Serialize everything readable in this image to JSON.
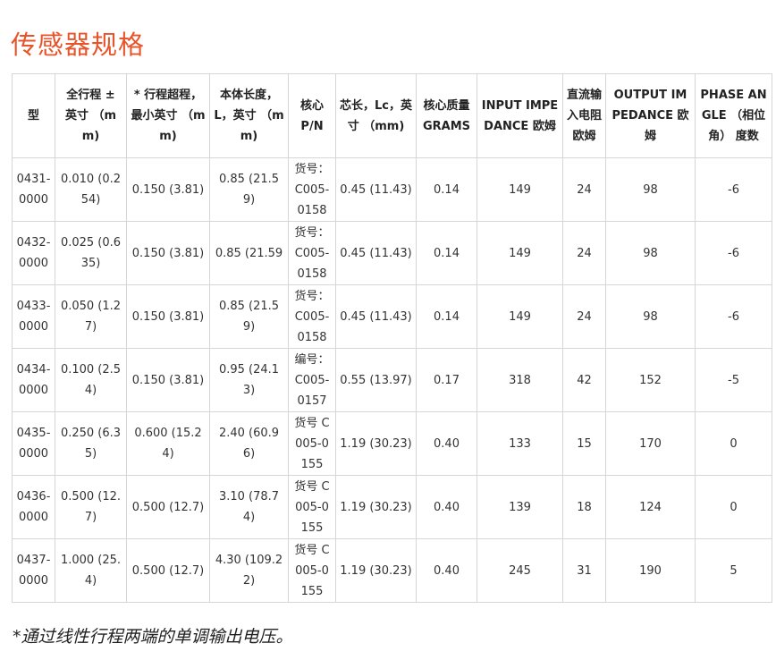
{
  "accent_color": "#e8542a",
  "page_title": "传感器规格",
  "table": {
    "headers": [
      "型",
      "全行程 ± 英寸 （mm)",
      "* 行程超程，最小英寸 （mm)",
      "本体长度，L，英寸 （mm)",
      "核心 P/N",
      "芯长，Lc，英寸 （mm)",
      "核心质量 GRAMS",
      "INPUT IMPEDANCE 欧姆",
      "直流输入电阻欧姆",
      "OUTPUT IMPEDANCE 欧姆",
      "PHASE ANGLE （相位角） 度数"
    ],
    "rows": [
      {
        "model": "0431-0000",
        "stroke": "0.010 (0.254)",
        "overtravel": "0.150 (3.81)",
        "body_length": "0.85 (21.59)",
        "core_pn": "货号：C005-0158",
        "core_length": "0.45 (11.43)",
        "core_mass": "0.14",
        "input_impedance": "149",
        "dc_resistance": "24",
        "output_impedance": "98",
        "phase_angle": "-6"
      },
      {
        "model": "0432-0000",
        "stroke": "0.025 (0.635)",
        "overtravel": "0.150 (3.81)",
        "body_length": "0.85 (21.59",
        "core_pn": "货号：C005-0158",
        "core_length": "0.45 (11.43)",
        "core_mass": "0.14",
        "input_impedance": "149",
        "dc_resistance": "24",
        "output_impedance": "98",
        "phase_angle": "-6"
      },
      {
        "model": "0433-0000",
        "stroke": "0.050 (1.27)",
        "overtravel": "0.150 (3.81)",
        "body_length": "0.85 (21.59)",
        "core_pn": "货号：C005-0158",
        "core_length": "0.45 (11.43)",
        "core_mass": "0.14",
        "input_impedance": "149",
        "dc_resistance": "24",
        "output_impedance": "98",
        "phase_angle": "-6"
      },
      {
        "model": "0434-0000",
        "stroke": "0.100 (2.54)",
        "overtravel": "0.150 (3.81)",
        "body_length": "0.95 (24.13)",
        "core_pn": "编号：C005-0157",
        "core_length": "0.55 (13.97)",
        "core_mass": "0.17",
        "input_impedance": "318",
        "dc_resistance": "42",
        "output_impedance": "152",
        "phase_angle": "-5"
      },
      {
        "model": "0435-0000",
        "stroke": "0.250 (6.35)",
        "overtravel": "0.600 (15.24)",
        "body_length": "2.40 (60.96)",
        "core_pn": "货号 C005-0155",
        "core_length": "1.19 (30.23)",
        "core_mass": "0.40",
        "input_impedance": "133",
        "dc_resistance": "15",
        "output_impedance": "170",
        "phase_angle": "0"
      },
      {
        "model": "0436-0000",
        "stroke": "0.500 (12.7)",
        "overtravel": "0.500 (12.7)",
        "body_length": "3.10 (78.74)",
        "core_pn": "货号 C005-0155",
        "core_length": "1.19 (30.23)",
        "core_mass": "0.40",
        "input_impedance": "139",
        "dc_resistance": "18",
        "output_impedance": "124",
        "phase_angle": "0"
      },
      {
        "model": "0437-0000",
        "stroke": "1.000 (25.4)",
        "overtravel": "0.500 (12.7)",
        "body_length": "4.30 (109.22)",
        "core_pn": "货号 C005-0155",
        "core_length": "1.19 (30.23)",
        "core_mass": "0.40",
        "input_impedance": "245",
        "dc_resistance": "31",
        "output_impedance": "190",
        "phase_angle": "5"
      }
    ]
  },
  "footnote": "*通过线性行程两端的单调输出电压。"
}
